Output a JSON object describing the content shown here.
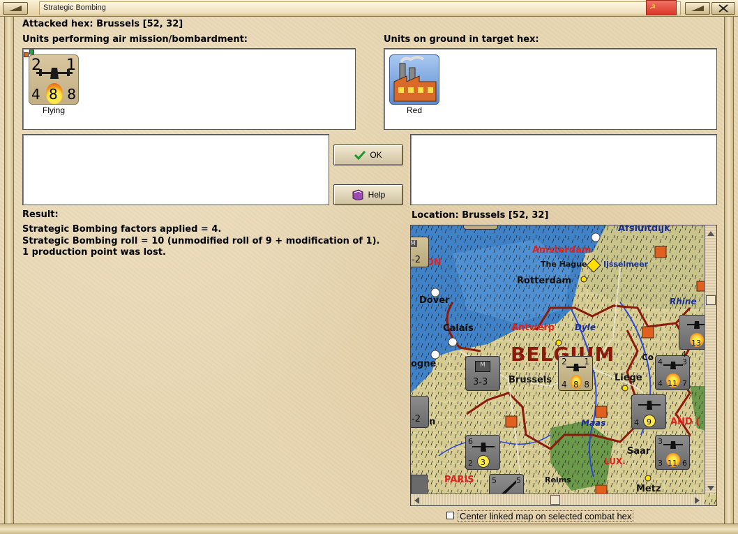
{
  "window": {
    "title": "Strategic Bombing"
  },
  "header": {
    "attacked_hex": "Attacked hex: Brussels  [52, 32]",
    "air_units_label": "Units performing air mission/bombardment:",
    "ground_units_label": "Units on ground in target hex:"
  },
  "air_unit": {
    "top_left": "2",
    "top_right": "1",
    "bottom_left": "4",
    "center": "8",
    "bottom_right": "8",
    "caption": "Flying"
  },
  "ground_unit": {
    "caption": "Red"
  },
  "buttons": {
    "ok": "OK",
    "help": "Help"
  },
  "result": {
    "label": "Result:",
    "lines": [
      "Strategic Bombing factors applied = 4.",
      "Strategic Bombing roll = 10 (unmodified roll of 9 + modification of 1).",
      "1 production point was lost."
    ]
  },
  "location": {
    "label": "Location:  Brussels  [52, 32]"
  },
  "map": {
    "places": {
      "afsluitdijk": "Afsluitdijk",
      "amsterdam": "Amsterdam",
      "london": "NDON",
      "the_hague": "The Hague",
      "ijsselmeer": "Ijsselmeer",
      "rotterdam": "Rotterdam",
      "dover": "Dover",
      "rhine": "Rhine",
      "calais": "Calais",
      "antwerp": "Antwerp",
      "dyle": "Dyle",
      "belgium": "BELGIUM",
      "boulogne": "ogne",
      "brussels": "Brussels",
      "liege": "Liege",
      "co": "Co",
      "rouen": "uen",
      "maas": "Maas",
      "and": "AND (",
      "saar": "Saar",
      "lux": "LUX.",
      "paris": "PARIS",
      "reims": "Reims",
      "metz": "Metz"
    },
    "counters": {
      "hq": {
        "top": "M",
        "bottom": "3-3"
      },
      "left_edge_1": "-2",
      "left_edge_2": "-2",
      "top_m": "M",
      "brussels_air": {
        "tl": "2",
        "tr": "1",
        "bl": "4",
        "c": "8",
        "br": "8"
      },
      "east1": {
        "tl": "4",
        "tr": "3",
        "bl": "4",
        "c": "11",
        "br": "7"
      },
      "east2": {
        "tl": "",
        "tr": "",
        "bl": "4",
        "c": "9",
        "br": ""
      },
      "east3": {
        "tl": "3",
        "tr": "",
        "bl": "3",
        "c": "11",
        "br": "6"
      },
      "south1": {
        "tl": "6",
        "bl": "2",
        "c": "3"
      },
      "south2": {
        "tl": "5",
        "tr": "5"
      },
      "ne": {
        "c": "13",
        "bl": "4"
      }
    }
  },
  "checkbox": {
    "label": "Center linked map on selected combat hex",
    "checked": false
  },
  "colors": {
    "parchment": "#e8d7b3",
    "city_red": "#e0221e",
    "river_blue": "#1a2fc4",
    "border_red": "#8b1a0c"
  }
}
